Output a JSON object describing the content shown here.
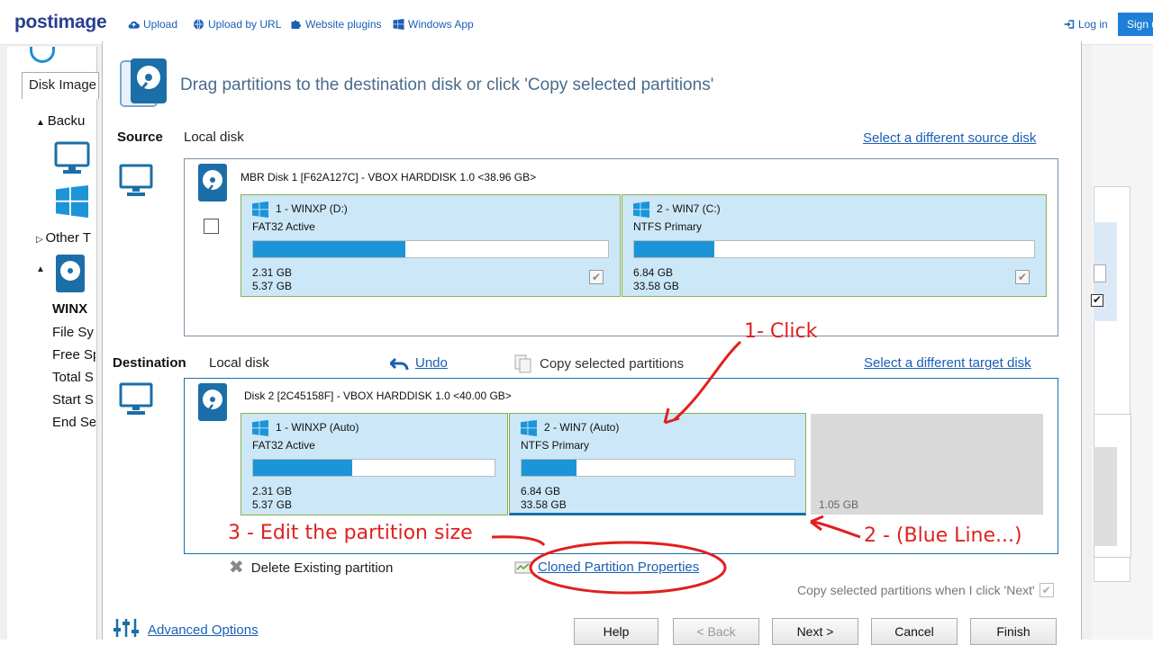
{
  "postimage": {
    "logo": "postimage",
    "nav": [
      {
        "label": "Upload",
        "icon": "cloud-upload-icon"
      },
      {
        "label": "Upload by URL",
        "icon": "globe-icon"
      },
      {
        "label": "Website plugins",
        "icon": "puzzle-icon"
      },
      {
        "label": "Windows App",
        "icon": "windows-icon"
      }
    ],
    "login": "Log in",
    "signup": "Sign u"
  },
  "background": {
    "tab": "Disk Image",
    "tree": [
      "Backu",
      "Other T"
    ],
    "selected": "WINX",
    "props": [
      "File Sy",
      "Free Sp",
      "Total S",
      "Start S",
      "End Se"
    ]
  },
  "dialog": {
    "header": "Drag partitions to the destination disk or click 'Copy selected partitions'",
    "source": {
      "label": "Source",
      "type": "Local disk",
      "link": "Select a different source disk",
      "disk_title": "MBR Disk 1 [F62A127C] - VBOX HARDDISK 1.0  <38.96 GB>",
      "partitions": [
        {
          "name": "1 - WINXP (D:)",
          "type": "FAT32 Active",
          "used": "2.31 GB",
          "total": "5.37 GB",
          "fill_pct": 43,
          "checked": true
        },
        {
          "name": "2 - WIN7 (C:)",
          "type": "NTFS Primary",
          "used": "6.84 GB",
          "total": "33.58 GB",
          "fill_pct": 20,
          "checked": true
        }
      ]
    },
    "destination": {
      "label": "Destination",
      "type": "Local disk",
      "undo": "Undo",
      "copy": "Copy selected partitions",
      "link": "Select a different target disk",
      "disk_title": "Disk 2 [2C45158F] - VBOX HARDDISK 1.0  <40.00 GB>",
      "partitions": [
        {
          "name": "1 - WINXP (Auto)",
          "type": "FAT32 Active",
          "used": "2.31 GB",
          "total": "5.37 GB",
          "fill_pct": 41
        },
        {
          "name": "2 - WIN7 (Auto)",
          "type": "NTFS Primary",
          "used": "6.84 GB",
          "total": "33.58 GB",
          "fill_pct": 20
        }
      ],
      "unallocated": "1.05 GB"
    },
    "delete_label": "Delete Existing partition",
    "cloned_props": "Cloned Partition Properties",
    "copy_on_next": "Copy selected partitions when I click 'Next'",
    "advanced": "Advanced Options",
    "buttons": {
      "help": "Help",
      "back": "< Back",
      "next": "Next >",
      "cancel": "Cancel",
      "finish": "Finish"
    }
  },
  "annotations": {
    "click": "1- Click",
    "blue_line": "2 - (Blue Line...)",
    "edit_size": "3 - Edit the partition size",
    "color": "#e02020"
  }
}
